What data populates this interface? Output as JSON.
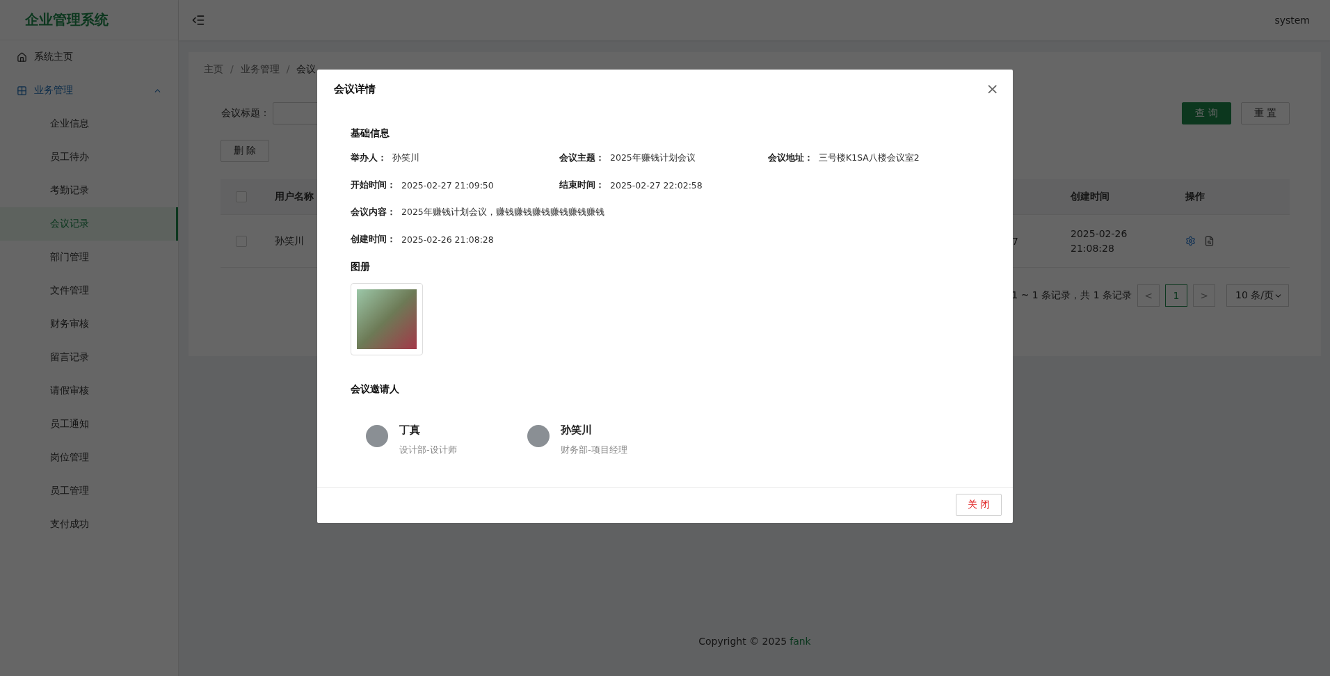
{
  "sidebar": {
    "title": "企业管理系统",
    "items": [
      {
        "label": "系统主页",
        "kind": "link",
        "selected": false
      },
      {
        "label": "业务管理",
        "kind": "group",
        "expanded": true,
        "selected": false,
        "children": [
          {
            "label": "企业信息",
            "selected": false
          },
          {
            "label": "员工待办",
            "selected": false
          },
          {
            "label": "考勤记录",
            "selected": false
          },
          {
            "label": "会议记录",
            "selected": true
          },
          {
            "label": "部门管理",
            "selected": false
          },
          {
            "label": "文件管理",
            "selected": false
          },
          {
            "label": "财务审核",
            "selected": false
          },
          {
            "label": "留言记录",
            "selected": false
          },
          {
            "label": "请假审核",
            "selected": false
          },
          {
            "label": "员工通知",
            "selected": false
          },
          {
            "label": "岗位管理",
            "selected": false
          },
          {
            "label": "员工管理",
            "selected": false
          },
          {
            "label": "支付成功",
            "selected": false
          }
        ]
      }
    ]
  },
  "header": {
    "user": "system"
  },
  "breadcrumb": {
    "separator": "/",
    "items": [
      "主页",
      "业务管理",
      "会议"
    ]
  },
  "search": {
    "label": "会议标题：",
    "buttons": [
      {
        "label": "查 询",
        "kind": "primary"
      },
      {
        "label": "重 置",
        "kind": "default"
      }
    ]
  },
  "delete_button": "删 除",
  "table": {
    "header_checked": false,
    "columns": [
      "用户名称",
      "创建时间",
      "操作"
    ],
    "rows": [
      {
        "checked": false,
        "user": "孙笑川",
        "column_3": "7",
        "created": "2025-02-26 21:08:28"
      }
    ]
  },
  "pagination": {
    "summary": "1 ~ 1 条记录，共 1 条记录",
    "prev": "<",
    "next": ">",
    "pages": [
      {
        "label": "1",
        "selected": true
      }
    ],
    "page_size": "10 条/页"
  },
  "footer": {
    "text": "Copyright © 2025",
    "link": "fank"
  },
  "modal": {
    "title": "会议详情",
    "close": "×",
    "basic_title": "基础信息",
    "fields": [
      {
        "label": "举办人：",
        "value": "孙笑川",
        "kind": "cell"
      },
      {
        "label": "会议主题：",
        "value": "2025年赚钱计划会议",
        "kind": "cell"
      },
      {
        "label": "会议地址：",
        "value": "三号楼K1SA八楼会议室2",
        "kind": "cell"
      },
      {
        "label": "开始时间：",
        "value": "2025-02-27 21:09:50",
        "kind": "cell"
      },
      {
        "label": "结束时间：",
        "value": "2025-02-27 22:02:58",
        "kind": "row_end"
      },
      {
        "label": "会议内容：",
        "value": "2025年赚钱计划会议，赚钱赚钱赚钱赚钱赚钱赚钱",
        "kind": "full"
      },
      {
        "label": "创建时间：",
        "value": "2025-02-26 21:08:28",
        "kind": "full"
      }
    ],
    "album_title": "图册",
    "invitees_title": "会议邀请人",
    "invitees": [
      {
        "name": "丁真",
        "role": "设计部-设计师"
      },
      {
        "name": "孙笑川",
        "role": "财务部-项目经理"
      }
    ],
    "close_button": "关 闭"
  }
}
